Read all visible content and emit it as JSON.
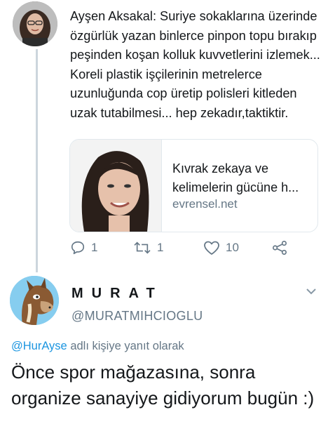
{
  "parent_tweet": {
    "author": "Ayşen Aksakal",
    "text": "Ayşen Aksakal: Suriye sokaklarına üzerinde özgürlük yazan binlerce pinpon topu bırakıp peşinden koşan kolluk kuvvetlerini izlemek... Koreli plastik işçilerinin metrelerce uzunluğunda cop üretip polisleri kitleden uzak tutabilmesi... hep zekadır,taktiktir.",
    "card": {
      "title": "Kıvrak zekaya ve kelimelerin gücüne h...",
      "domain": "evrensel.net"
    },
    "actions": {
      "reply_count": "1",
      "retweet_count": "1",
      "like_count": "10"
    }
  },
  "reply_tweet": {
    "display_name": "MURAT",
    "handle": "@MURATMIHCIOGLU",
    "reply_prefix_mention": "@HurAyse",
    "reply_prefix_text": " adlı kişiye yanıt olarak",
    "text": "Önce spor mağazasına, sonra organize sanayiye gidiyorum bugün :)"
  },
  "colors": {
    "text": "#14171a",
    "secondary": "#657786",
    "link": "#1b95e0",
    "border": "#e1e8ed"
  },
  "icons": {
    "reply": "reply-icon",
    "retweet": "retweet-icon",
    "like": "heart-icon",
    "share": "share-icon",
    "menu": "chevron-down-icon"
  }
}
